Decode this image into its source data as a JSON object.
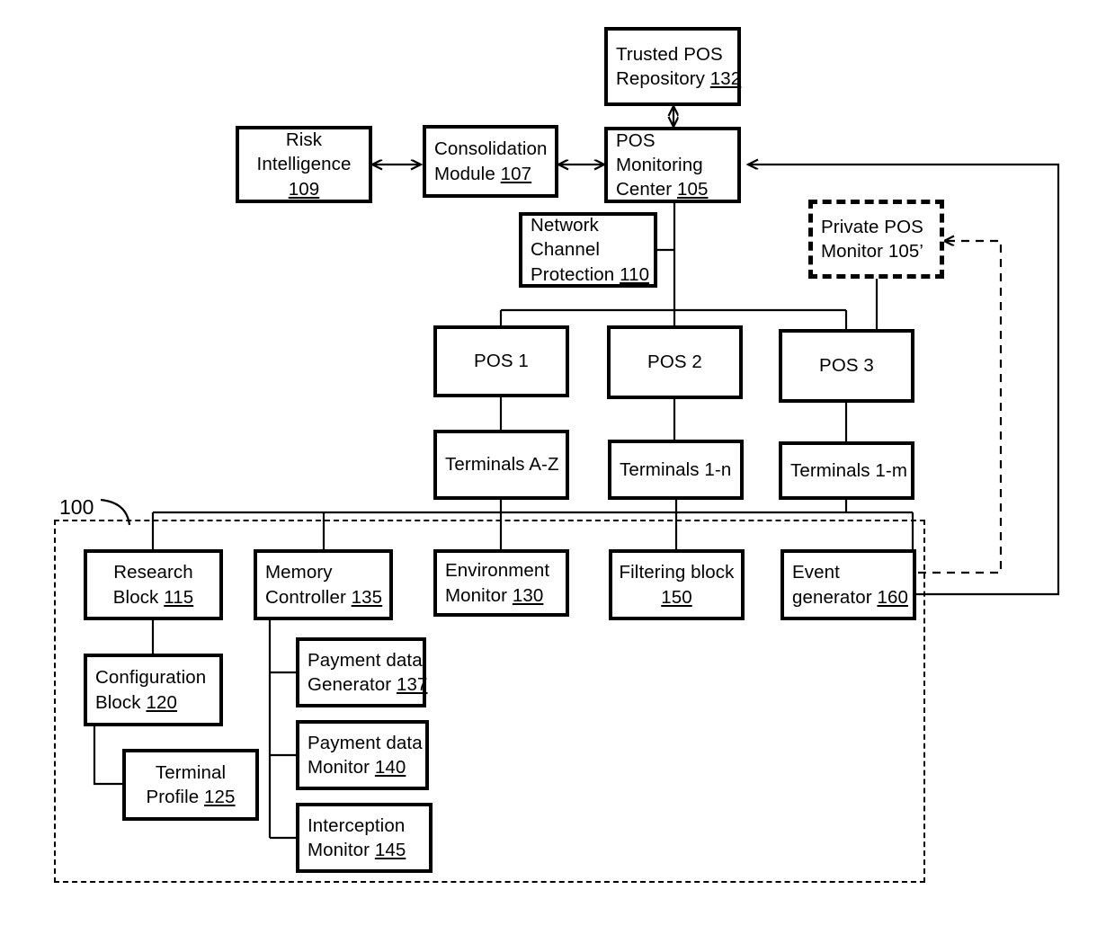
{
  "diagram": {
    "figure_ref": "100",
    "nodes": [
      {
        "id": "trusted_pos_repository",
        "lines": [
          "Trusted POS",
          "Repository "
        ],
        "ref": "132",
        "align": "left"
      },
      {
        "id": "risk_intelligence",
        "lines": [
          "Risk",
          "Intelligence",
          ""
        ],
        "ref": "109",
        "align": "ctr"
      },
      {
        "id": "consolidation_module",
        "lines": [
          "Consolidation",
          "Module  "
        ],
        "ref": "107",
        "align": "left"
      },
      {
        "id": "pos_monitoring_center",
        "lines": [
          "POS",
          "Monitoring",
          "Center "
        ],
        "ref": "105",
        "align": "left"
      },
      {
        "id": "network_channel_protection",
        "lines": [
          "Network",
          "Channel",
          "Protection "
        ],
        "ref": "110",
        "align": "left"
      },
      {
        "id": "private_pos_monitor",
        "lines": [
          "Private POS",
          "Monitor 105’"
        ],
        "ref": "",
        "align": "left"
      },
      {
        "id": "pos_1",
        "lines": [
          "POS 1"
        ],
        "ref": "",
        "align": "ctr"
      },
      {
        "id": "pos_2",
        "lines": [
          "POS 2"
        ],
        "ref": "",
        "align": "ctr"
      },
      {
        "id": "pos_3",
        "lines": [
          "POS 3"
        ],
        "ref": "",
        "align": "ctr"
      },
      {
        "id": "terminals_az",
        "lines": [
          "Terminals A-Z"
        ],
        "ref": "",
        "align": "left"
      },
      {
        "id": "terminals_1n",
        "lines": [
          "Terminals 1-n"
        ],
        "ref": "",
        "align": "left"
      },
      {
        "id": "terminals_1m",
        "lines": [
          "Terminals 1-m"
        ],
        "ref": "",
        "align": "left"
      },
      {
        "id": "research_block",
        "lines": [
          "Research",
          "Block "
        ],
        "ref": "115",
        "align": "ctr"
      },
      {
        "id": "memory_controller",
        "lines": [
          "Memory",
          "Controller "
        ],
        "ref": "135",
        "align": "left"
      },
      {
        "id": "environment_monitor",
        "lines": [
          "Environment",
          "Monitor "
        ],
        "ref": "130",
        "align": "left"
      },
      {
        "id": "filtering_block",
        "lines": [
          "Filtering block",
          ""
        ],
        "ref": "150",
        "align": "ctr"
      },
      {
        "id": "event_generator",
        "lines": [
          "Event",
          "generator "
        ],
        "ref": "160",
        "align": "left"
      },
      {
        "id": "configuration_block",
        "lines": [
          "Configuration",
          "Block "
        ],
        "ref": "120",
        "align": "left"
      },
      {
        "id": "terminal_profile",
        "lines": [
          "Terminal",
          "Profile  "
        ],
        "ref": "125",
        "align": "ctr"
      },
      {
        "id": "payment_data_generator",
        "lines": [
          "Payment data",
          "Generator "
        ],
        "ref": "137",
        "align": "left"
      },
      {
        "id": "payment_data_monitor",
        "lines": [
          "Payment data",
          "Monitor "
        ],
        "ref": "140",
        "align": "left"
      },
      {
        "id": "interception_monitor",
        "lines": [
          "Interception",
          "Monitor "
        ],
        "ref": "145",
        "align": "left"
      }
    ]
  }
}
